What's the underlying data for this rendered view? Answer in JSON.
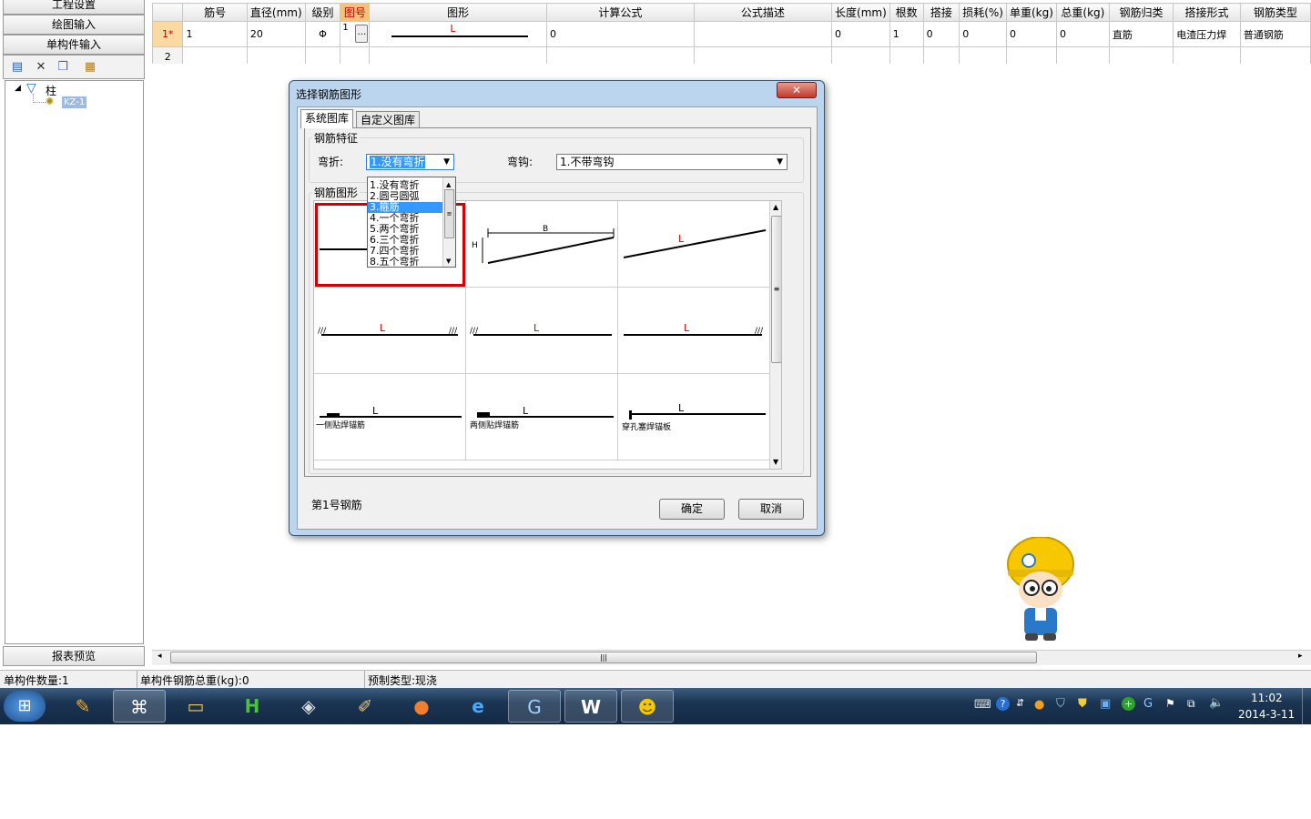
{
  "left_nav": {
    "project_settings": "工程设置",
    "drawing_input": "绘图输入",
    "single_component_input": "单构件输入",
    "report_preview": "报表预览"
  },
  "tree": {
    "root": "柱",
    "child": "KZ-1"
  },
  "grid": {
    "headers": [
      "筋号",
      "直径(mm)",
      "级别",
      "图号",
      "图形",
      "计算公式",
      "公式描述",
      "长度(mm)",
      "根数",
      "搭接",
      "损耗(%)",
      "单重(kg)",
      "总重(kg)",
      "钢筋归类",
      "搭接形式",
      "钢筋类型"
    ],
    "rows": [
      {
        "row_no": "1*",
        "bar_no": "1",
        "diameter": "20",
        "grade": "Φ",
        "shape_no": "1",
        "shape_label": "L",
        "formula": "0",
        "desc": "",
        "length": "0",
        "count": "1",
        "lap": "0",
        "loss": "0",
        "unit_weight": "0",
        "total_weight": "0",
        "category": "直筋",
        "lap_form": "电渣压力焊",
        "bar_type": "普通钢筋"
      },
      {
        "row_no": "2"
      }
    ]
  },
  "status": {
    "component_count": "单构件数量:1",
    "total_weight": "单构件钢筋总重(kg):0",
    "precast_type": "预制类型:现浇"
  },
  "dialog": {
    "title": "选择钢筋图形",
    "tab_system": "系统图库",
    "tab_custom": "自定义图库",
    "group_feature": "钢筋特征",
    "bend_label": "弯折:",
    "bend_value": "1.没有弯折",
    "hook_label": "弯钩:",
    "hook_value": "1.不带弯钩",
    "group_shape": "钢筋图形",
    "dropdown_options": [
      "1.没有弯折",
      "2.圆弓圆弧",
      "3.箍筋",
      "4.一个弯折",
      "5.两个弯折",
      "6.三个弯折",
      "7.四个弯折",
      "8.五个弯折"
    ],
    "dropdown_selected_index": 2,
    "shape_labels": {
      "L": "L",
      "B": "B",
      "H": "H",
      "one_side": "一侧贴焊锚筋",
      "two_side": "两侧贴焊锚筋",
      "perforated": "穿孔塞焊锚板"
    },
    "footer_text": "第1号钢筋",
    "ok_label": "确定",
    "cancel_label": "取消"
  },
  "taskbar": {
    "time": "11:02",
    "date": "2014-3-11"
  },
  "colors": {
    "accent_red": "#d40000",
    "selection_blue": "#3399ff",
    "dialog_frame": "#bcd5ee",
    "taskbar": "#1a3452"
  }
}
